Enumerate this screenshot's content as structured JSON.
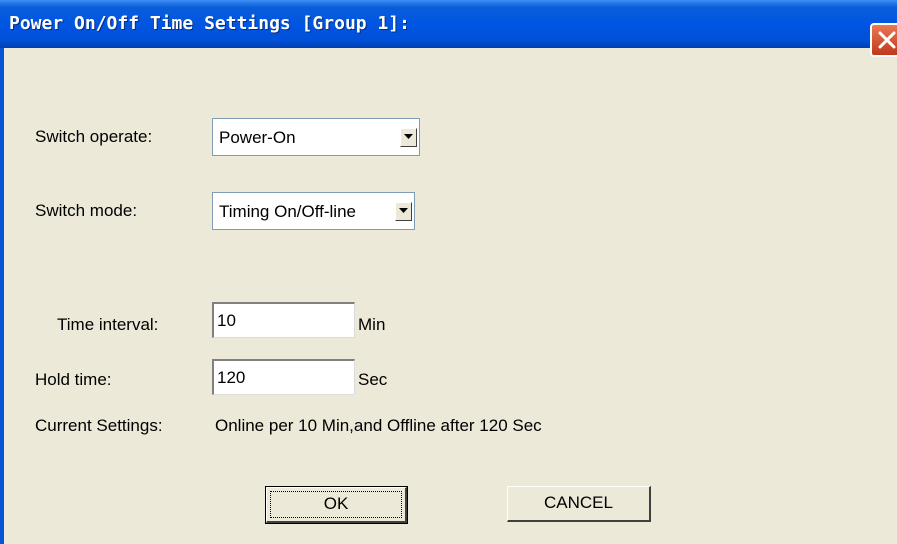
{
  "window": {
    "title": "Power On/Off Time Settings [Group 1]:"
  },
  "switch_operate": {
    "label": "Switch operate:",
    "value": "Power-On"
  },
  "switch_mode": {
    "label": "Switch  mode:",
    "value": "Timing On/Off-line"
  },
  "time_interval": {
    "label": "Time interval:",
    "value": "10",
    "unit": "Min"
  },
  "hold_time": {
    "label": "Hold time:",
    "value": "120",
    "unit": "Sec"
  },
  "current_settings": {
    "label": "Current Settings:",
    "value": "Online per 10 Min,and Offline after 120 Sec"
  },
  "buttons": {
    "ok": "OK",
    "cancel": "CANCEL"
  },
  "icons": {
    "close": "close-icon",
    "dropdown": "chevron-down-icon"
  }
}
